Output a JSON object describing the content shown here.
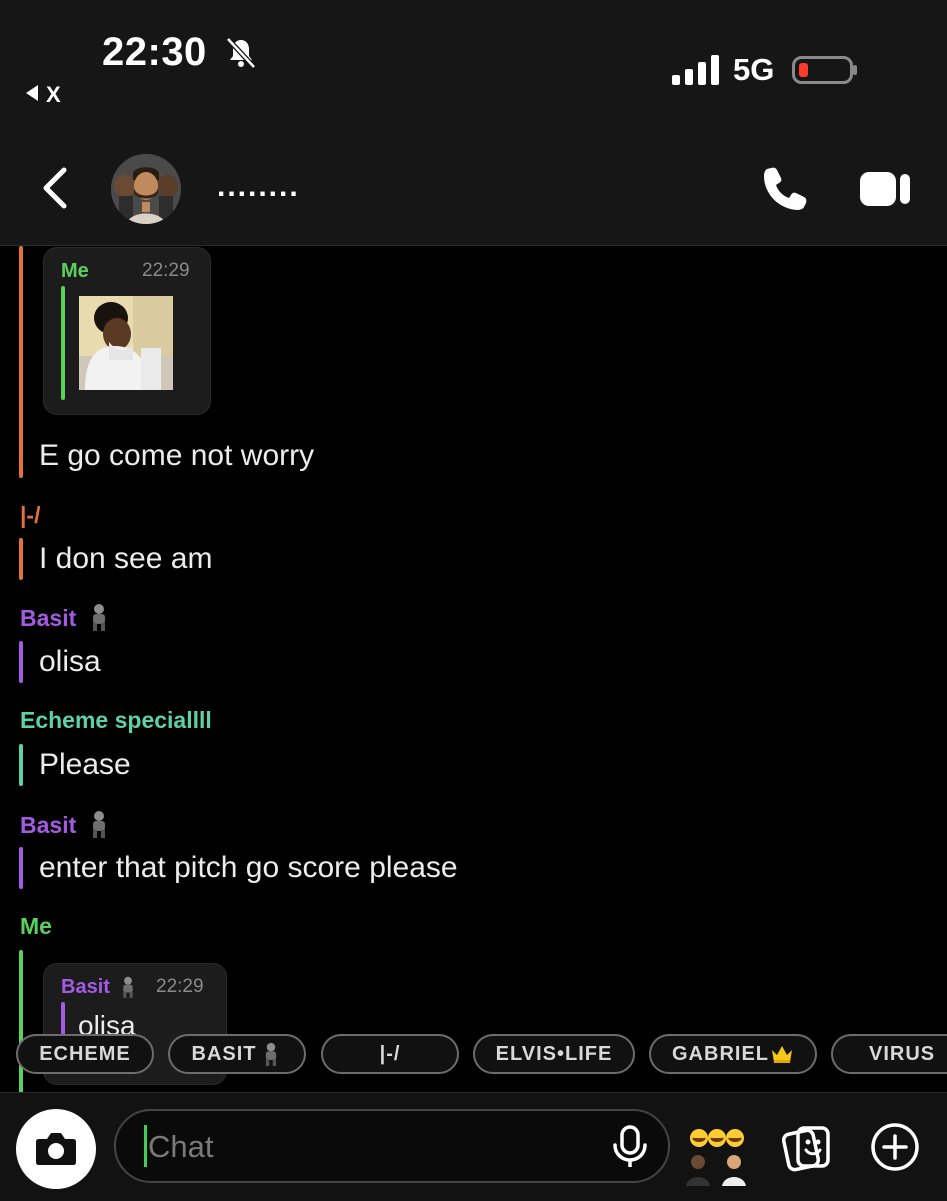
{
  "status_bar": {
    "time": "22:30",
    "network": "5G",
    "back_to_app": "X",
    "icons": [
      "bell-muted-icon",
      "signal-icon",
      "battery-icon"
    ]
  },
  "header": {
    "title": "........",
    "icons": [
      "back-icon",
      "group-avatar",
      "phone-icon",
      "video-icon"
    ]
  },
  "colors": {
    "me": "#5bd15b",
    "pipe": "#e0723a",
    "basit": "#a35be3",
    "echeme": "#5ed0a8",
    "accent_cursor": "#3ecf5d"
  },
  "messages": {
    "reply1": {
      "quoted_sender": "Me",
      "quoted_time": "22:29",
      "text": "E go come not worry"
    },
    "m2": {
      "sender": "|-/",
      "text": "I don see am"
    },
    "m3": {
      "sender": "Basit",
      "text": "olisa"
    },
    "m4": {
      "sender": "Echeme speciallll",
      "text": "Please"
    },
    "m5": {
      "sender": "Basit",
      "text": "enter that pitch go score please"
    },
    "m6": {
      "sender": "Me",
      "quoted_sender": "Basit",
      "quoted_time": "22:29",
      "quoted_text": "olisa"
    }
  },
  "mention_chips": [
    {
      "label": "ECHEME"
    },
    {
      "label": "BASIT"
    },
    {
      "label": "|-/"
    },
    {
      "label": "ELVIS•LIFE"
    },
    {
      "label": "GABRIEL"
    },
    {
      "label": "VIRUS"
    }
  ],
  "composer": {
    "placeholder": "Chat",
    "value": "",
    "icons": [
      "camera-icon",
      "mic-icon",
      "bitmoji-icon",
      "sticker-icon",
      "plus-icon"
    ]
  }
}
